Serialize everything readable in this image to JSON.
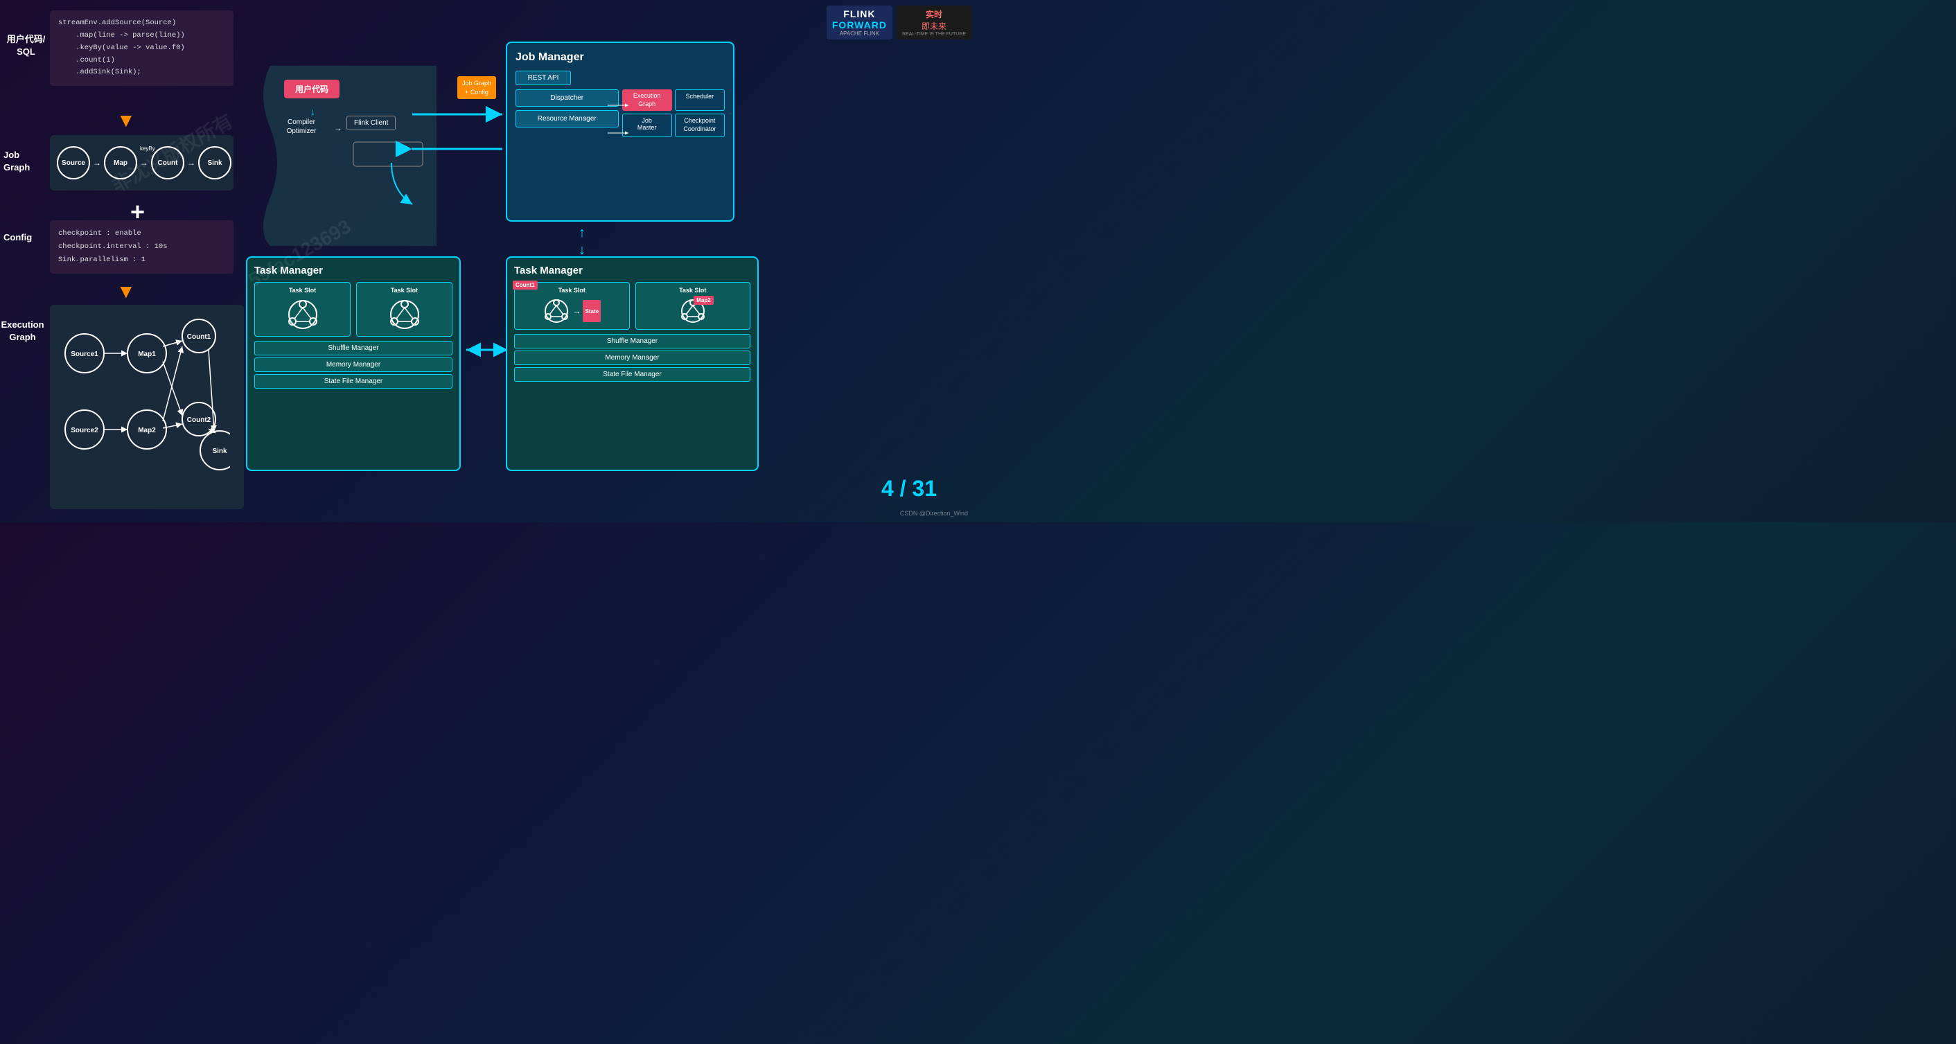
{
  "logo": {
    "flink": "FLINK",
    "forward": "FORWARD",
    "shihou": "实时\n即未来"
  },
  "left": {
    "userCode": {
      "label": "用户代码/\nSQL",
      "code": "streamEnv.addSource(Source)\n    .map(line -> parse(line))\n    .keyBy(value -> value.f0)\n    .count(1)\n    .addSink(Sink);"
    },
    "jobGraph": {
      "label": "Job\nGraph",
      "nodes": [
        "Source",
        "Map",
        "Count",
        "Sink"
      ],
      "keyBy": "keyBy"
    },
    "config": {
      "label": "Config",
      "text": "checkpoint : enable\ncheckpoint.interval : 10s\nSink.parallelism : 1"
    },
    "executionGraph": {
      "label": "Execution\nGraph",
      "nodes": [
        "Source1",
        "Map1",
        "Count1",
        "Source2",
        "Map2",
        "Count2",
        "Sink"
      ]
    }
  },
  "middle": {
    "userCodeBox": "用户代码",
    "compilerLabel": "Compiler\nOptimizer",
    "flinkClientLabel": "Flink Client",
    "jobGraphConfig": "Job Graph\n+ Config"
  },
  "jobManager": {
    "title": "Job Manager",
    "restApi": "REST API",
    "dispatcher": "Dispatcher",
    "resourceManager": "Resource Manager",
    "executionGraph": "Execution\nGraph",
    "jobMaster": "Job\nMaster",
    "scheduler": "Scheduler",
    "checkpointCoordinator": "Checkpoint\nCoordinator"
  },
  "taskManager1": {
    "title": "Task Manager",
    "slot1": "Task Slot",
    "slot2": "Task Slot",
    "shuffleManager": "Shuffle Manager",
    "memoryManager": "Memory Manager",
    "stateFileManager": "State File Manager"
  },
  "taskManager2": {
    "title": "Task Manager",
    "count1Label": "Count1",
    "slot1": "Task Slot",
    "slot2": "Task Slot",
    "map2Label": "Map2",
    "stateLabel": "State",
    "shuffleManager": "Shuffle Manager",
    "memoryManager": "Memory Manager",
    "stateFileManager": "State File Manager"
  },
  "pageNumber": "4 / 31",
  "csdn": "CSDN @Direction_Wind",
  "watermarks": [
    "非沈义版权所有",
    "59fac123693"
  ]
}
